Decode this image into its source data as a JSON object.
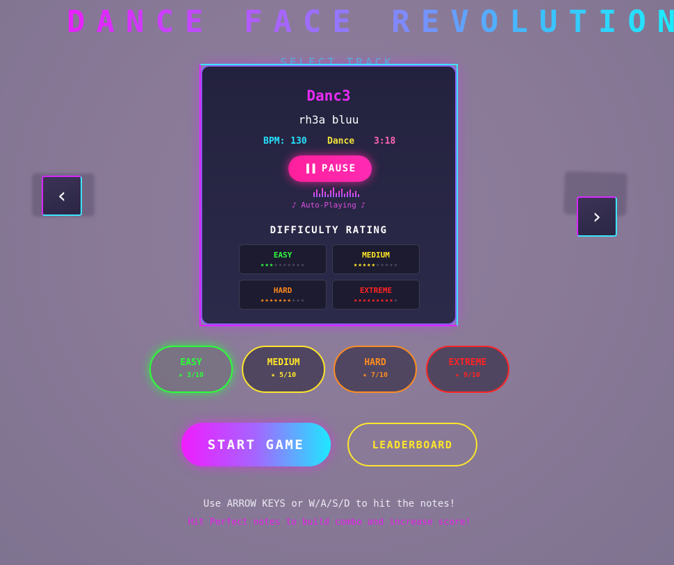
{
  "header": {
    "title": "DANCE FACE REVOLUTION",
    "subtitle": "SELECT TRACK"
  },
  "song": {
    "title": "Danc3",
    "artist": "rh3a bluu",
    "bpm": "BPM: 130",
    "genre": "Dance",
    "duration": "3:18",
    "pause_icon": "▐▐",
    "pause_label": "PAUSE",
    "status": "♪ Auto-Playing ♪"
  },
  "difficulty_rating": {
    "heading": "DIFFICULTY RATING",
    "levels": [
      {
        "name": "EASY",
        "rating": 3,
        "max": 10
      },
      {
        "name": "MEDIUM",
        "rating": 5,
        "max": 10
      },
      {
        "name": "HARD",
        "rating": 7,
        "max": 10
      },
      {
        "name": "EXTREME",
        "rating": 9,
        "max": 10
      }
    ]
  },
  "nav": {
    "prev_glyph": "‹",
    "next_glyph": "›"
  },
  "difficulty_buttons": [
    {
      "name": "EASY",
      "rating_text": "★ 3/10",
      "color": "#2bff3a",
      "selected": true
    },
    {
      "name": "MEDIUM",
      "rating_text": "★ 5/10",
      "color": "#ffe62a",
      "selected": false
    },
    {
      "name": "HARD",
      "rating_text": "★ 7/10",
      "color": "#ff8c21",
      "selected": false
    },
    {
      "name": "EXTREME",
      "rating_text": "★ 9/10",
      "color": "#ff2424",
      "selected": false
    }
  ],
  "actions": {
    "start_label": "START GAME",
    "leaderboard_label": "LEADERBOARD"
  },
  "instructions": {
    "line1": "Use ARROW KEYS or W/A/S/D to hit the notes!",
    "line2": "Hit Perfect notes to build combo and increase score!"
  },
  "colors": {
    "magenta": "#e91eff",
    "cyan": "#19f0ff",
    "pink": "#ff1f9c",
    "yellow": "#ffe62a",
    "green": "#2bff3a",
    "orange": "#ff8c21",
    "red": "#ff2424"
  }
}
